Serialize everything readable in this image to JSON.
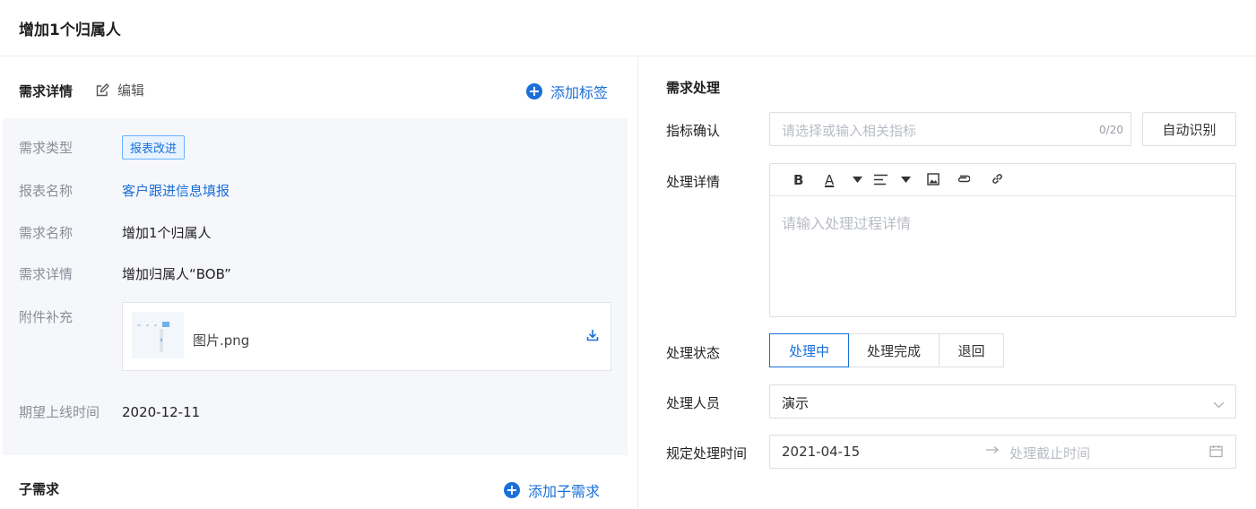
{
  "header": {
    "title": "增加1个归属人"
  },
  "left": {
    "section_title": "需求详情",
    "edit_label": "编辑",
    "add_tag_label": "添加标签",
    "fields": {
      "type_label": "需求类型",
      "type_tag": "报表改进",
      "report_label": "报表名称",
      "report_value": "客户跟进信息填报",
      "name_label": "需求名称",
      "name_value": "增加1个归属人",
      "detail_label": "需求详情",
      "detail_value": "增加归属人“BOB”",
      "attach_label": "附件补充",
      "attach_file": "图片.png",
      "date_label": "期望上线时间",
      "date_value": "2020-12-11"
    },
    "sub_title": "子需求",
    "add_sub_label": "添加子需求"
  },
  "right": {
    "section_title": "需求处理",
    "indicator_label": "指标确认",
    "indicator_placeholder": "请选择或输入相关指标",
    "indicator_count": "0/20",
    "auto_button": "自动识别",
    "detail_label": "处理详情",
    "toolbar_bold": "B",
    "toolbar_color": "A",
    "detail_placeholder": "请输入处理过程详情",
    "status_label": "处理状态",
    "status_options": [
      "处理中",
      "处理完成",
      "退回"
    ],
    "handler_label": "处理人员",
    "handler_value": "演示",
    "deadline_label": "规定处理时间",
    "deadline_start": "2021-04-15",
    "deadline_end_placeholder": "处理截止时间"
  },
  "colors": {
    "accent": "#1a6fd8",
    "panel_bg": "#f6f7fb"
  }
}
